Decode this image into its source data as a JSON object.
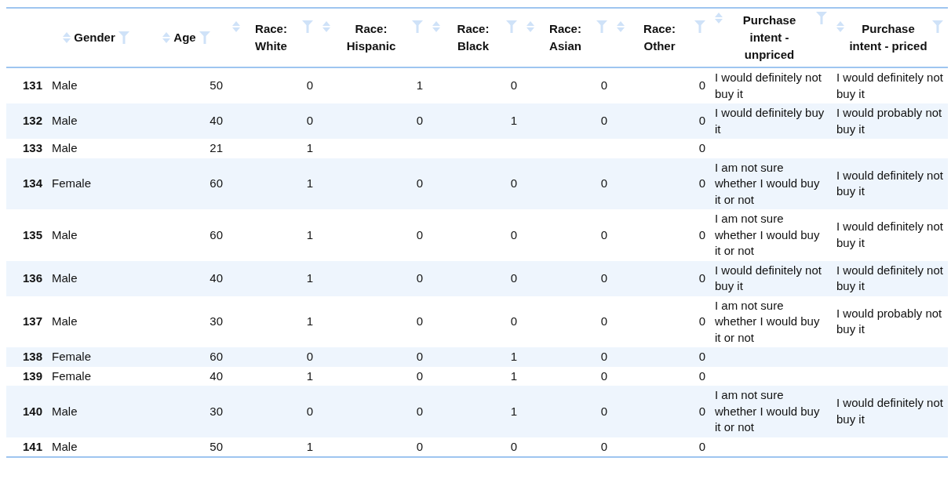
{
  "table": {
    "columns": [
      "Gender",
      "Age",
      "Race: White",
      "Race: Hispanic",
      "Race: Black",
      "Race: Asian",
      "Race: Other",
      "Purchase intent - unpriced",
      "Purchase intent - priced"
    ],
    "rows": [
      {
        "index": "131",
        "cells": [
          "Male",
          "50",
          "0",
          "1",
          "0",
          "0",
          "0",
          "I would definitely not buy it",
          "I would definitely not buy it"
        ]
      },
      {
        "index": "132",
        "cells": [
          "Male",
          "40",
          "0",
          "0",
          "1",
          "0",
          "0",
          "I would definitely buy it",
          "I would probably not buy it"
        ]
      },
      {
        "index": "133",
        "cells": [
          "Male",
          "21",
          "1",
          null,
          null,
          null,
          "0",
          null,
          null
        ]
      },
      {
        "index": "134",
        "cells": [
          "Female",
          "60",
          "1",
          "0",
          "0",
          "0",
          "0",
          "I am not sure whether I would buy it or not",
          "I would definitely not buy it"
        ]
      },
      {
        "index": "135",
        "cells": [
          "Male",
          "60",
          "1",
          "0",
          "0",
          "0",
          "0",
          "I am not sure whether I would buy it or not",
          "I would definitely not buy it"
        ]
      },
      {
        "index": "136",
        "cells": [
          "Male",
          "40",
          "1",
          "0",
          "0",
          "0",
          "0",
          "I would definitely not buy it",
          "I would definitely not buy it"
        ]
      },
      {
        "index": "137",
        "cells": [
          "Male",
          "30",
          "1",
          "0",
          "0",
          "0",
          "0",
          "I am not sure whether I would buy it or not",
          "I would probably not buy it"
        ]
      },
      {
        "index": "138",
        "cells": [
          "Female",
          "60",
          "0",
          "0",
          "1",
          "0",
          "0",
          null,
          null
        ]
      },
      {
        "index": "139",
        "cells": [
          "Female",
          "40",
          "1",
          "0",
          "1",
          "0",
          "0",
          null,
          null
        ]
      },
      {
        "index": "140",
        "cells": [
          "Male",
          "30",
          "0",
          "0",
          "1",
          "0",
          "0",
          "I am not sure whether I would buy it or not",
          "I would definitely not buy it"
        ]
      },
      {
        "index": "141",
        "cells": [
          "Male",
          "50",
          "1",
          "0",
          "0",
          "0",
          "0",
          null,
          null
        ]
      }
    ]
  }
}
